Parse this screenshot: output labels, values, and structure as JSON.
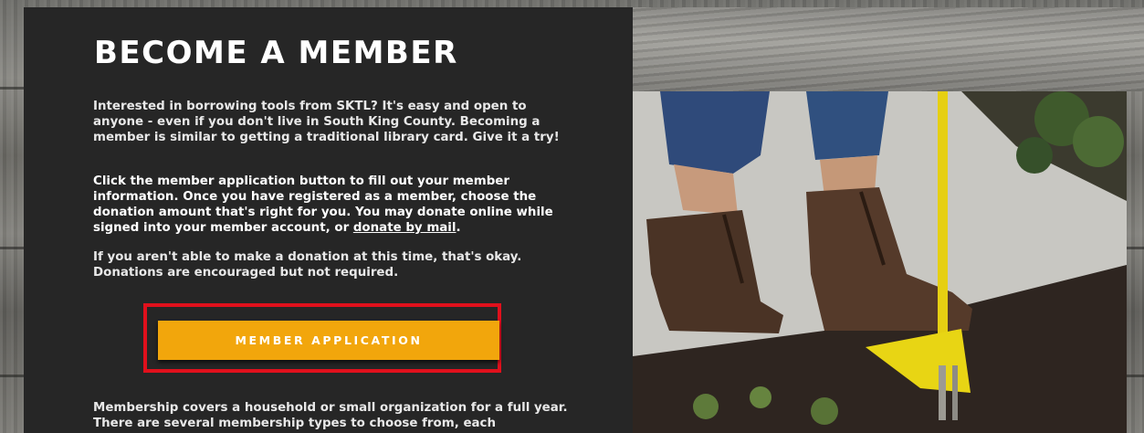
{
  "section": {
    "title": "BECOME A MEMBER",
    "paragraph1": "Interested in borrowing tools from SKTL? It's easy and open to anyone - even if you don't live in South King County. Becoming a member is similar to getting a traditional library card. Give it a try!",
    "paragraph2_text": "Click the member application button to fill out your member information. Once you have registered as a member, choose the donation amount that's right for you. You may donate online while signed into your member account, or ",
    "paragraph2_link": "donate by mail",
    "paragraph2_end": ".",
    "paragraph3": "If you aren't able to make a donation at this time, that's okay. Donations are encouraged but not required.",
    "button_label": "MEMBER APPLICATION",
    "paragraph4": "Membership covers a household or small organization for a full year. There are several membership types to choose from, each"
  },
  "colors": {
    "panel": "#262626",
    "button": "#f2a60c",
    "highlight": "#e0101c"
  }
}
